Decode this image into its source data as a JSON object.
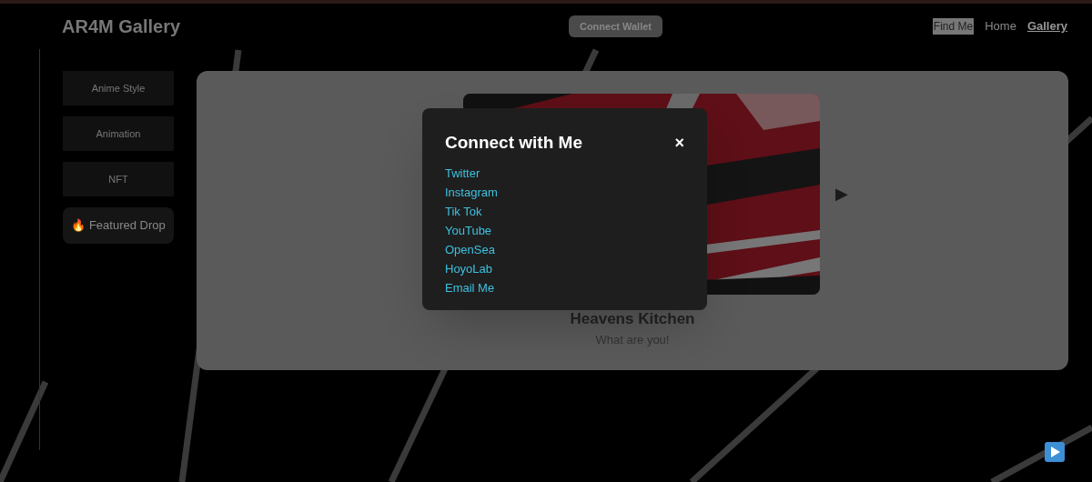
{
  "header": {
    "title": "AR4M Gallery",
    "connect_button": "Connect Wallet",
    "nav": [
      {
        "label": "Find Me",
        "highlighted": true,
        "selected": false
      },
      {
        "label": "Home",
        "highlighted": false,
        "selected": false
      },
      {
        "label": "Gallery",
        "highlighted": false,
        "selected": true
      }
    ]
  },
  "sidebar": {
    "items": [
      {
        "label": "Anime Style",
        "kind": "category"
      },
      {
        "label": "Animation",
        "kind": "category"
      },
      {
        "label": "NFT",
        "kind": "category"
      },
      {
        "label": "Featured Drop",
        "icon": "🔥",
        "kind": "featured"
      }
    ]
  },
  "card": {
    "next_arrow": "▶",
    "title": "Heavens Kitchen",
    "subtitle": "What are you!"
  },
  "modal": {
    "title": "Connect with Me",
    "close": "×",
    "links": [
      "Twitter",
      "Instagram",
      "Tik Tok",
      "YouTube",
      "OpenSea",
      "HoyoLab",
      "Email Me"
    ]
  }
}
